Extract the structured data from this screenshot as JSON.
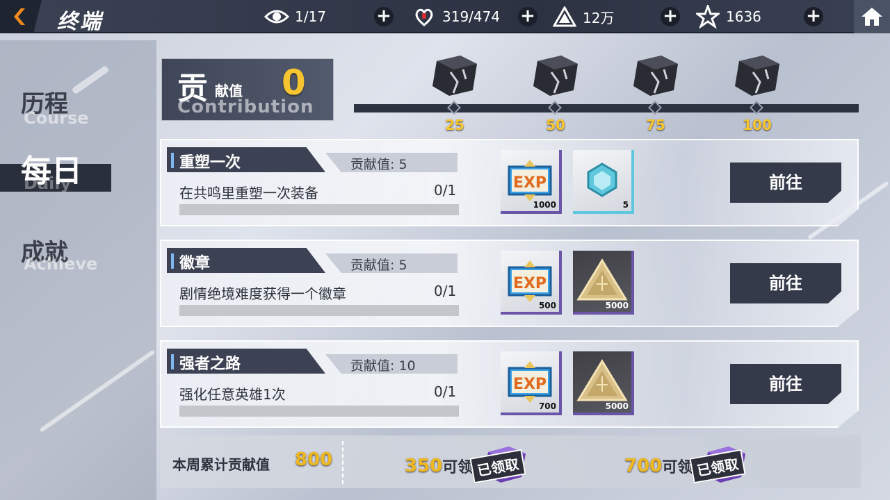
{
  "header": {
    "title": "终端",
    "stamina": "1/17",
    "hearts": "319/474",
    "coins": "12万",
    "stars": "1636"
  },
  "nav": {
    "items": [
      {
        "zh": "历程",
        "en": "Course"
      },
      {
        "zh": "每日",
        "en": "Daily"
      },
      {
        "zh": "成就",
        "en": "Achieve"
      }
    ]
  },
  "contribution": {
    "big_char": "贡",
    "rest": "献值",
    "en": "Contribution",
    "value": "0",
    "milestones": [
      "25",
      "50",
      "75",
      "100"
    ]
  },
  "tasks": [
    {
      "name": "重塑一次",
      "reward_label": "贡献值: 5",
      "desc": "在共鸣里重塑一次装备",
      "count": "0/1",
      "items": [
        {
          "icon": "exp-card-icon",
          "qty": "1000"
        },
        {
          "icon": "crystal-hexagon-icon",
          "qty": "5"
        }
      ],
      "button": "前往"
    },
    {
      "name": "徽章",
      "reward_label": "贡献值: 5",
      "desc": "剧情绝境难度获得一个徽章",
      "count": "0/1",
      "items": [
        {
          "icon": "exp-card-icon",
          "qty": "500"
        },
        {
          "icon": "triangle-coin-icon",
          "qty": "5000"
        }
      ],
      "button": "前往"
    },
    {
      "name": "强者之路",
      "reward_label": "贡献值: 10",
      "desc": "强化任意英雄1次",
      "count": "0/1",
      "items": [
        {
          "icon": "exp-card-icon",
          "qty": "700"
        },
        {
          "icon": "triangle-coin-icon",
          "qty": "5000"
        }
      ],
      "button": "前往"
    }
  ],
  "weekly": {
    "label": "本周累计贡献值",
    "value": "800",
    "claims": [
      {
        "need": "350",
        "text": "可领",
        "stamp": "已领取"
      },
      {
        "need": "700",
        "text": "可领",
        "stamp": "已领取"
      }
    ]
  },
  "colors": {
    "accent_gold": "#f7c530",
    "dark_panel": "#343a4a",
    "purple_rarity": "#6a55a8",
    "cyan_rarity": "#5fc8dc"
  }
}
